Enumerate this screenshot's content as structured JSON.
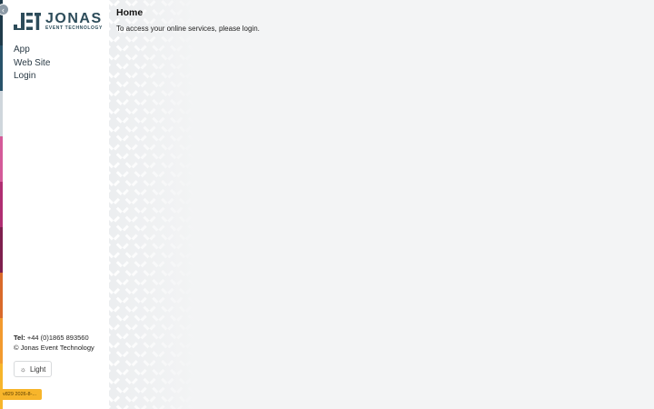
{
  "sidebar": {
    "logo": {
      "name": "JONAS",
      "tagline": "EVENT TECHNOLOGY"
    },
    "nav": [
      "App",
      "Web Site",
      "Login"
    ],
    "contact": {
      "tel_label": "Tel:",
      "tel_value": "+44 (0)1865 893560",
      "copyright": "© Jonas Event Technology"
    },
    "theme_toggle": {
      "icon": "sun-icon",
      "label": "Light"
    },
    "version": "v829 2026-8-..."
  },
  "main": {
    "title": "Home",
    "message": "To access your online services, please login."
  },
  "colors": {
    "strip": [
      "#1f3a4a",
      "#28526a",
      "#cfd6dc",
      "#d45a99",
      "#b02e72",
      "#7e1f4e",
      "#d96a2b",
      "#f29a2e",
      "#f7b52b"
    ],
    "brand": "#2d4c5a",
    "version_badge": "#f7b52b"
  }
}
